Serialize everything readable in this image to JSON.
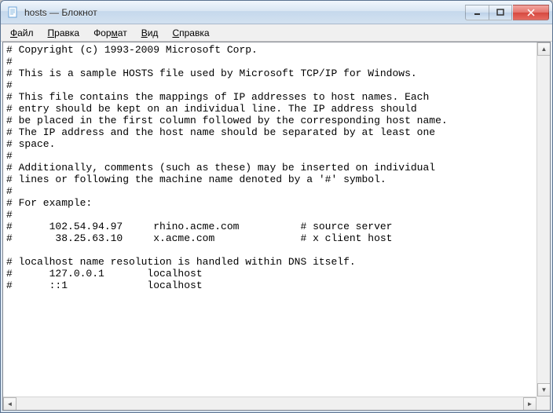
{
  "titlebar": {
    "title": "hosts — Блокнот"
  },
  "menubar": {
    "items": [
      {
        "label": "Файл",
        "accel": "Ф"
      },
      {
        "label": "Правка",
        "accel": "П"
      },
      {
        "label": "Формат",
        "accel": "Ф"
      },
      {
        "label": "Вид",
        "accel": "В"
      },
      {
        "label": "Справка",
        "accel": "С"
      }
    ]
  },
  "icons": {
    "minimize": "–",
    "maximize": "□",
    "close": "✕"
  },
  "content": "# Copyright (c) 1993-2009 Microsoft Corp.\n#\n# This is a sample HOSTS file used by Microsoft TCP/IP for Windows.\n#\n# This file contains the mappings of IP addresses to host names. Each\n# entry should be kept on an individual line. The IP address should\n# be placed in the first column followed by the corresponding host name.\n# The IP address and the host name should be separated by at least one\n# space.\n#\n# Additionally, comments (such as these) may be inserted on individual\n# lines or following the machine name denoted by a '#' symbol.\n#\n# For example:\n#\n#      102.54.94.97     rhino.acme.com          # source server\n#       38.25.63.10     x.acme.com              # x client host\n\n# localhost name resolution is handled within DNS itself.\n#      127.0.0.1       localhost\n#      ::1             localhost"
}
